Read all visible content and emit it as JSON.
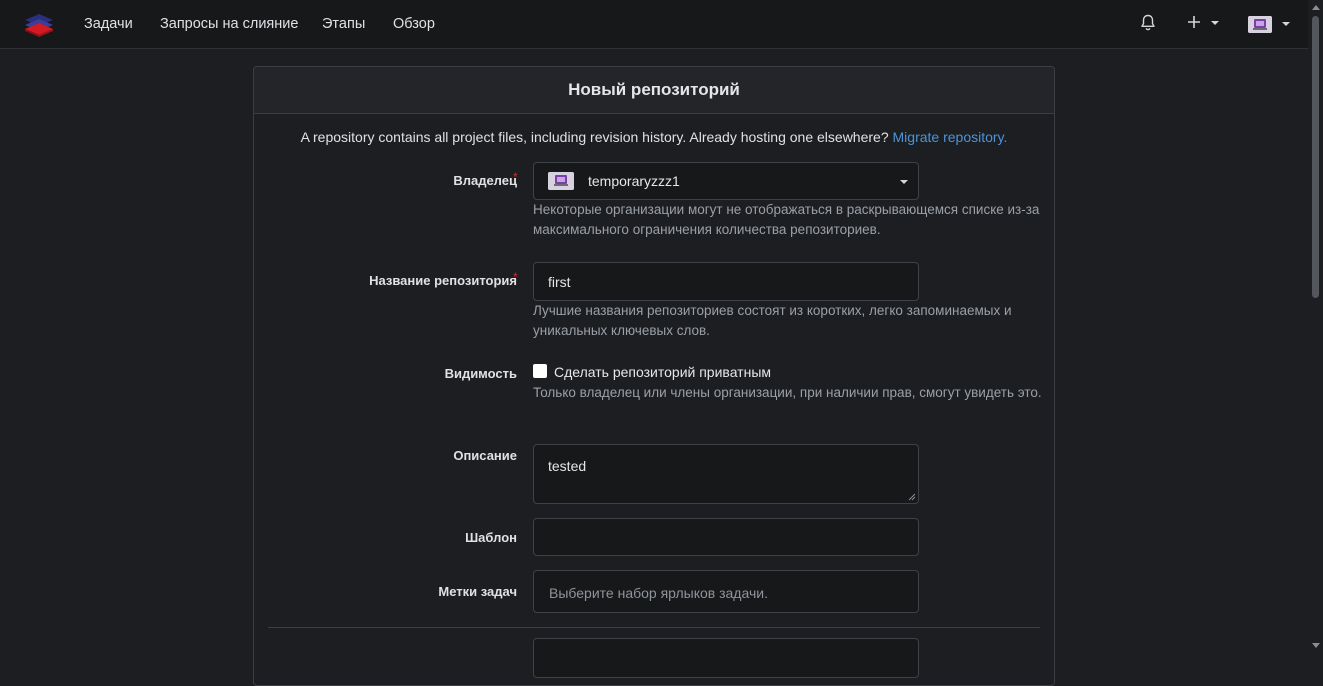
{
  "nav": {
    "items": [
      "Задачи",
      "Запросы на слияние",
      "Этапы",
      "Обзор"
    ],
    "bell_icon": "bell-icon",
    "plus_icon": "plus-icon",
    "colors": {
      "bar": "#171819",
      "logo_red": "#c8161f",
      "logo_blue": "#2b2f7e"
    }
  },
  "panel": {
    "title": "Новый репозиторий",
    "intro_text": "A repository contains all project files, including revision history. Already hosting one elsewhere?",
    "intro_link": "Migrate repository."
  },
  "form": {
    "owner": {
      "label": "Владелец",
      "required_mark": "*",
      "value": "temporaryzzz1",
      "help": "Некоторые организации могут не отображаться в раскрывающемся списке из-за максимального ограничения количества репозиториев."
    },
    "repo_name": {
      "label": "Название репозитория",
      "required_mark": "*",
      "value": "first",
      "help": "Лучшие названия репозиториев состоят из коротких, легко запоминаемых и уникальных ключевых слов."
    },
    "visibility": {
      "label": "Видимость",
      "checkbox_label": "Сделать репозиторий приватным",
      "checked": false,
      "help": "Только владелец или члены организации, при наличии прав, смогут увидеть это."
    },
    "description": {
      "label": "Описание",
      "value": "tested"
    },
    "template": {
      "label": "Шаблон",
      "value": ""
    },
    "issue_labels": {
      "label": "Метки задач",
      "placeholder": "Выберите набор ярлыков задачи."
    }
  }
}
